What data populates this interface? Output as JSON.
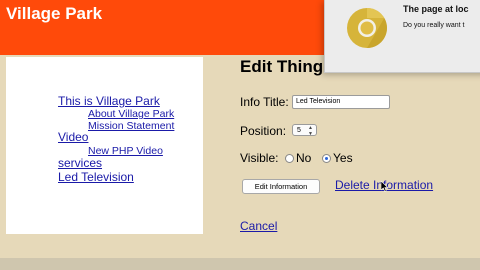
{
  "site": {
    "title": "Village Park"
  },
  "sidebar": {
    "items": [
      {
        "label": "This is Village Park"
      },
      {
        "label": "About Village Park"
      },
      {
        "label": "Mission Statement"
      },
      {
        "label": "Video"
      },
      {
        "label": "New PHP Video"
      },
      {
        "label": "services"
      },
      {
        "label": "Led Television"
      }
    ]
  },
  "main": {
    "heading": "Edit Thing",
    "info_title_label": "Info Title:",
    "info_title_value": "Led Television",
    "position_label": "Position:",
    "position_value": "5",
    "visible_label": "Visible:",
    "visible_no": "No",
    "visible_yes": "Yes",
    "visible_selected": "Yes",
    "edit_button": "Edit Information",
    "delete_link": "Delete Information",
    "cancel_link": "Cancel"
  },
  "alert": {
    "title": "The page at loc",
    "body": "Do you really want t"
  },
  "colors": {
    "header": "#ff4a0a",
    "page_bg": "#e6d9b9",
    "link": "#1a1aa8"
  }
}
